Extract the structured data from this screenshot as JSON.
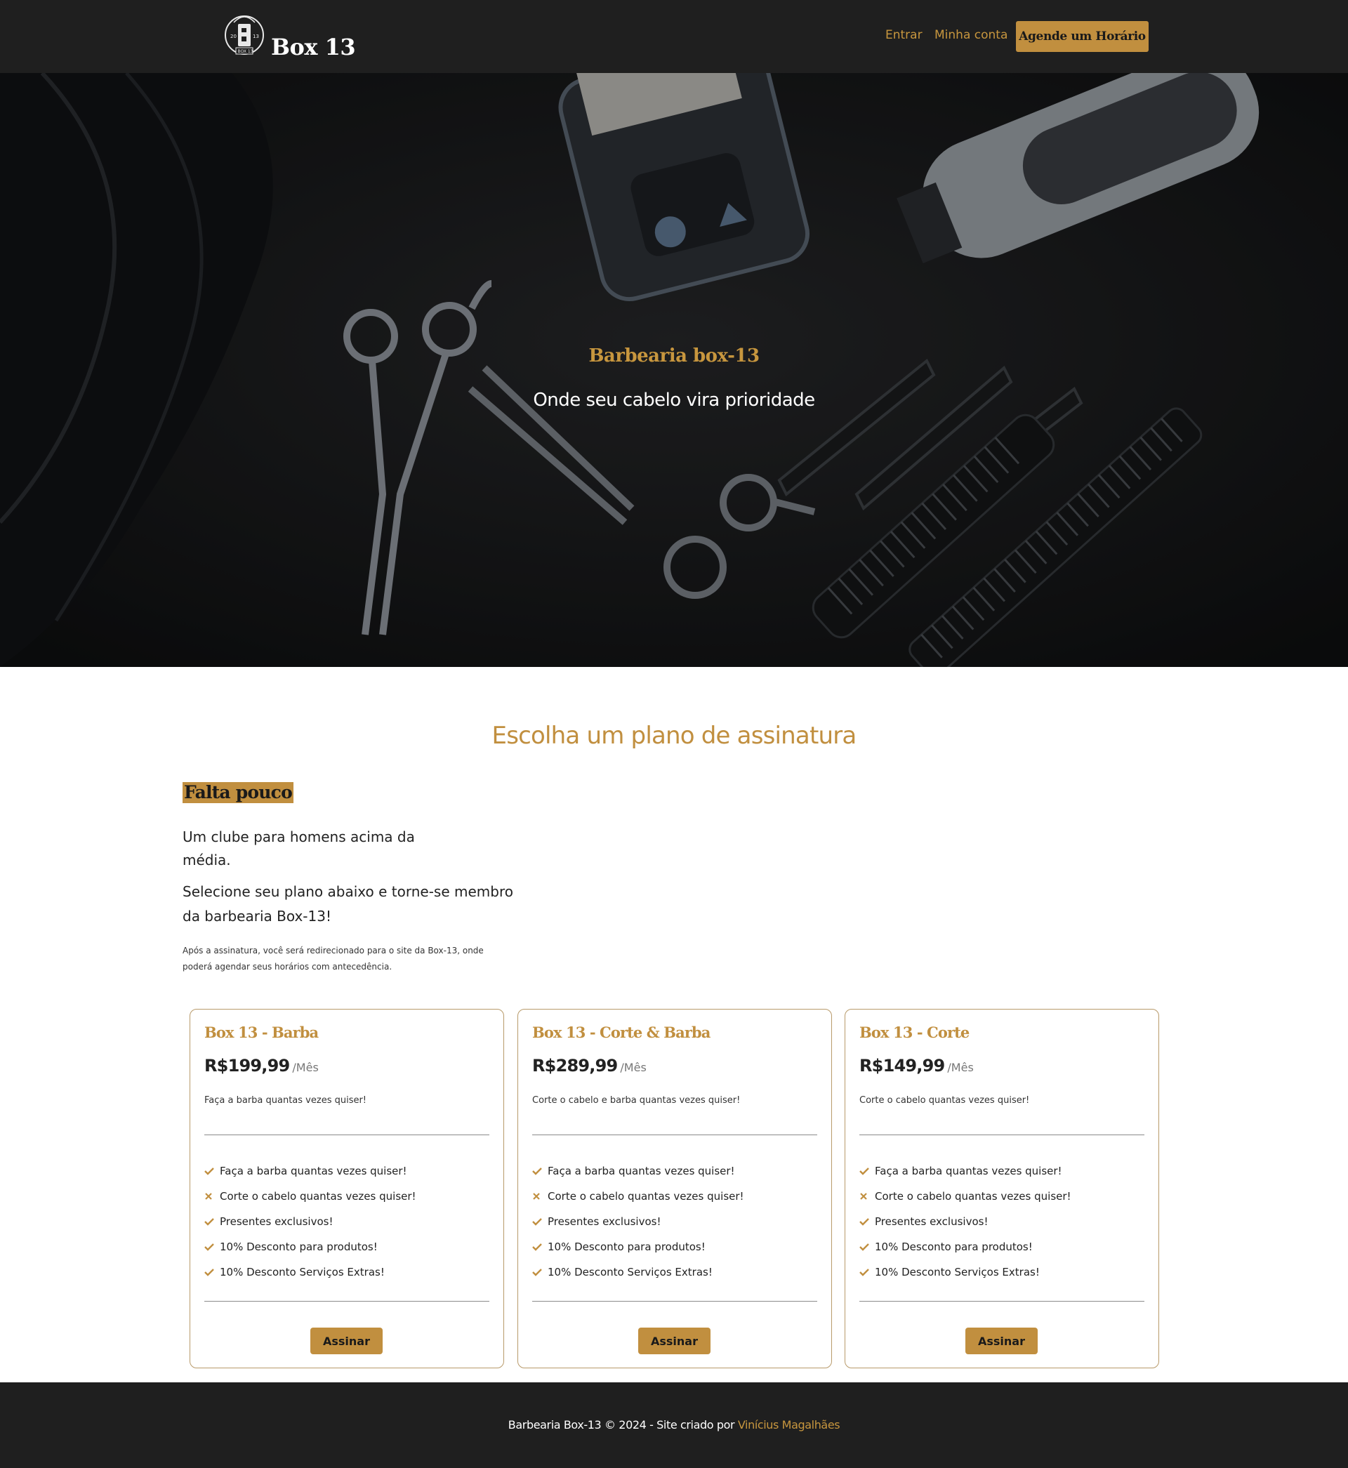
{
  "header": {
    "brand": "Box 13",
    "nav": [
      {
        "label": "Entrar"
      },
      {
        "label": "Minha conta"
      }
    ],
    "cta_label": "Agende um Horário"
  },
  "hero": {
    "title": "Barbearia box-13",
    "subtitle": "Onde seu cabelo vira prioridade"
  },
  "main": {
    "section_title": "Escolha um plano de assinatura",
    "tag": "Falta pouco",
    "intro1": "Um clube para homens acima da média.",
    "intro2": "Selecione seu plano abaixo e torne-se membro da barbearia Box-13!",
    "note": "Após a assinatura, você será redirecionado para o site da Box-13, onde poderá agendar seus horários com antecedência."
  },
  "plans": [
    {
      "title": "Box 13 - Barba",
      "price": "R$199,99",
      "period": "/Mês",
      "description": "Faça a barba quantas vezes quiser!",
      "features": [
        {
          "label": "Faça a barba quantas vezes quiser!",
          "included": true
        },
        {
          "label": "Corte o cabelo quantas vezes quiser!",
          "included": false
        },
        {
          "label": "Presentes exclusivos!",
          "included": true
        },
        {
          "label": "10% Desconto para produtos!",
          "included": true
        },
        {
          "label": "10% Desconto Serviços Extras!",
          "included": true
        }
      ],
      "button": "Assinar"
    },
    {
      "title": "Box 13 - Corte & Barba",
      "price": "R$289,99",
      "period": "/Mês",
      "description": "Corte o cabelo e barba quantas vezes quiser!",
      "features": [
        {
          "label": "Faça a barba quantas vezes quiser!",
          "included": true
        },
        {
          "label": "Corte o cabelo quantas vezes quiser!",
          "included": false
        },
        {
          "label": "Presentes exclusivos!",
          "included": true
        },
        {
          "label": "10% Desconto para produtos!",
          "included": true
        },
        {
          "label": "10% Desconto Serviços Extras!",
          "included": true
        }
      ],
      "button": "Assinar"
    },
    {
      "title": "Box 13 - Corte",
      "price": "R$149,99",
      "period": "/Mês",
      "description": "Corte o cabelo quantas vezes quiser!",
      "features": [
        {
          "label": "Faça a barba quantas vezes quiser!",
          "included": true
        },
        {
          "label": "Corte o cabelo quantas vezes quiser!",
          "included": false
        },
        {
          "label": "Presentes exclusivos!",
          "included": true
        },
        {
          "label": "10% Desconto para produtos!",
          "included": true
        },
        {
          "label": "10% Desconto Serviços Extras!",
          "included": true
        }
      ],
      "button": "Assinar"
    }
  ],
  "footer": {
    "text": "Barbearia Box-13 © 2024 - Site criado por ",
    "author": "Vinícius Magalhães"
  },
  "icons": {
    "included": "check-icon",
    "excluded": "cross-icon",
    "logo": "barbershop-logo-icon"
  },
  "colors": {
    "accent": "#c18f3f",
    "header_bg": "#1f1f1f",
    "hero_bg": "#171819"
  }
}
